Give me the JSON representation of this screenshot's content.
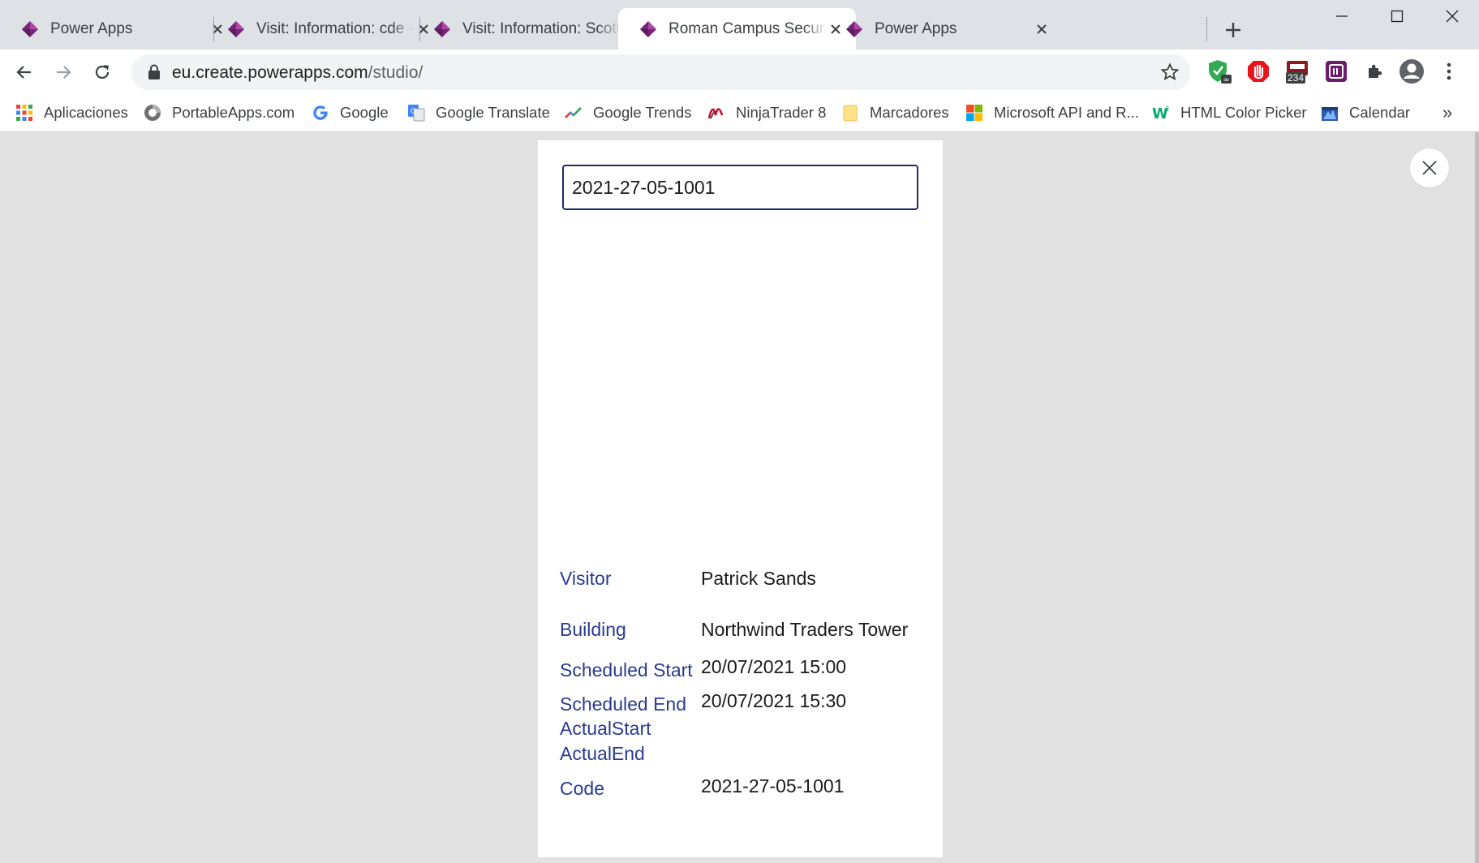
{
  "browser": {
    "tabs": [
      {
        "title": "Power Apps",
        "active": false
      },
      {
        "title": "Visit: Information: cde -",
        "active": false
      },
      {
        "title": "Visit: Information: Scott K",
        "active": false
      },
      {
        "title": "Roman Campus Security",
        "active": true
      },
      {
        "title": "Power Apps",
        "active": false
      }
    ],
    "address": {
      "host": "eu.create.powerapps.com",
      "path": "/studio/"
    },
    "extension_badge": "234",
    "bookmarks": [
      {
        "label": "Aplicaciones",
        "icon": "apps-grid-icon"
      },
      {
        "label": "PortableApps.com",
        "icon": "portableapps-icon"
      },
      {
        "label": "Google",
        "icon": "google-icon"
      },
      {
        "label": "Google Translate",
        "icon": "google-translate-icon"
      },
      {
        "label": "Google Trends",
        "icon": "google-trends-icon"
      },
      {
        "label": "NinjaTrader 8",
        "icon": "ninjatrader-icon"
      },
      {
        "label": "Marcadores",
        "icon": "folder-icon"
      },
      {
        "label": "Microsoft API and R...",
        "icon": "microsoft-icon"
      },
      {
        "label": "HTML Color Picker",
        "icon": "w3schools-icon"
      },
      {
        "label": "Calendar",
        "icon": "calendar-icon"
      }
    ],
    "bookmarks_overflow": "»"
  },
  "app": {
    "search_value": "2021-27-05-1001",
    "details": {
      "visitor": {
        "label": "Visitor",
        "value": "Patrick Sands"
      },
      "building": {
        "label": "Building",
        "value": "Northwind Traders Tower"
      },
      "scheduled_start": {
        "label": "Scheduled Start",
        "value": "20/07/2021 15:00"
      },
      "scheduled_end": {
        "label": "Scheduled End",
        "value": "20/07/2021 15:30"
      },
      "actual_start": {
        "label": "ActualStart",
        "value": ""
      },
      "actual_end": {
        "label": "ActualEnd",
        "value": ""
      },
      "code": {
        "label": "Code",
        "value": "2021-27-05-1001"
      }
    }
  },
  "colors": {
    "label_blue": "#2b3a8f",
    "input_border": "#1f2a6b",
    "powerapps_purple": "#742774",
    "canvas_grey": "#e1e1e1"
  }
}
